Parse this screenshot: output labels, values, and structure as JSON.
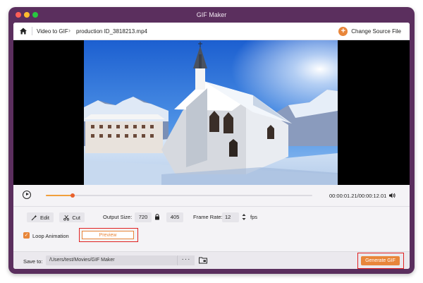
{
  "window": {
    "title": "GIF Maker"
  },
  "breadcrumb": {
    "home_icon": "home-icon",
    "items": [
      "Video to GIF",
      "production ID_3818213.mp4"
    ],
    "change_source_label": "Change Source File"
  },
  "playback": {
    "current_time": "00:00:01.21",
    "total_time": "00:00:12.01",
    "time_display": "00:00:01.21/00:00:12.01",
    "progress_fraction": 0.1
  },
  "edit": {
    "edit_label": "Edit",
    "cut_label": "Cut",
    "output_size_label": "Output Size:",
    "width": "720",
    "height": "405",
    "frame_rate_label": "Frame Rate:",
    "frame_rate": "12",
    "fps_label": "fps"
  },
  "options": {
    "loop_label": "Loop Animation",
    "loop_checked": true,
    "preview_label": "Preview"
  },
  "save": {
    "label": "Save to:",
    "path": "/Users/test/Movies/GIF Maker",
    "browse_label": "···",
    "generate_label": "Generate GIF"
  },
  "colors": {
    "accent": "#e8863a",
    "window": "#5b2f5e",
    "highlight": "#e02020"
  }
}
